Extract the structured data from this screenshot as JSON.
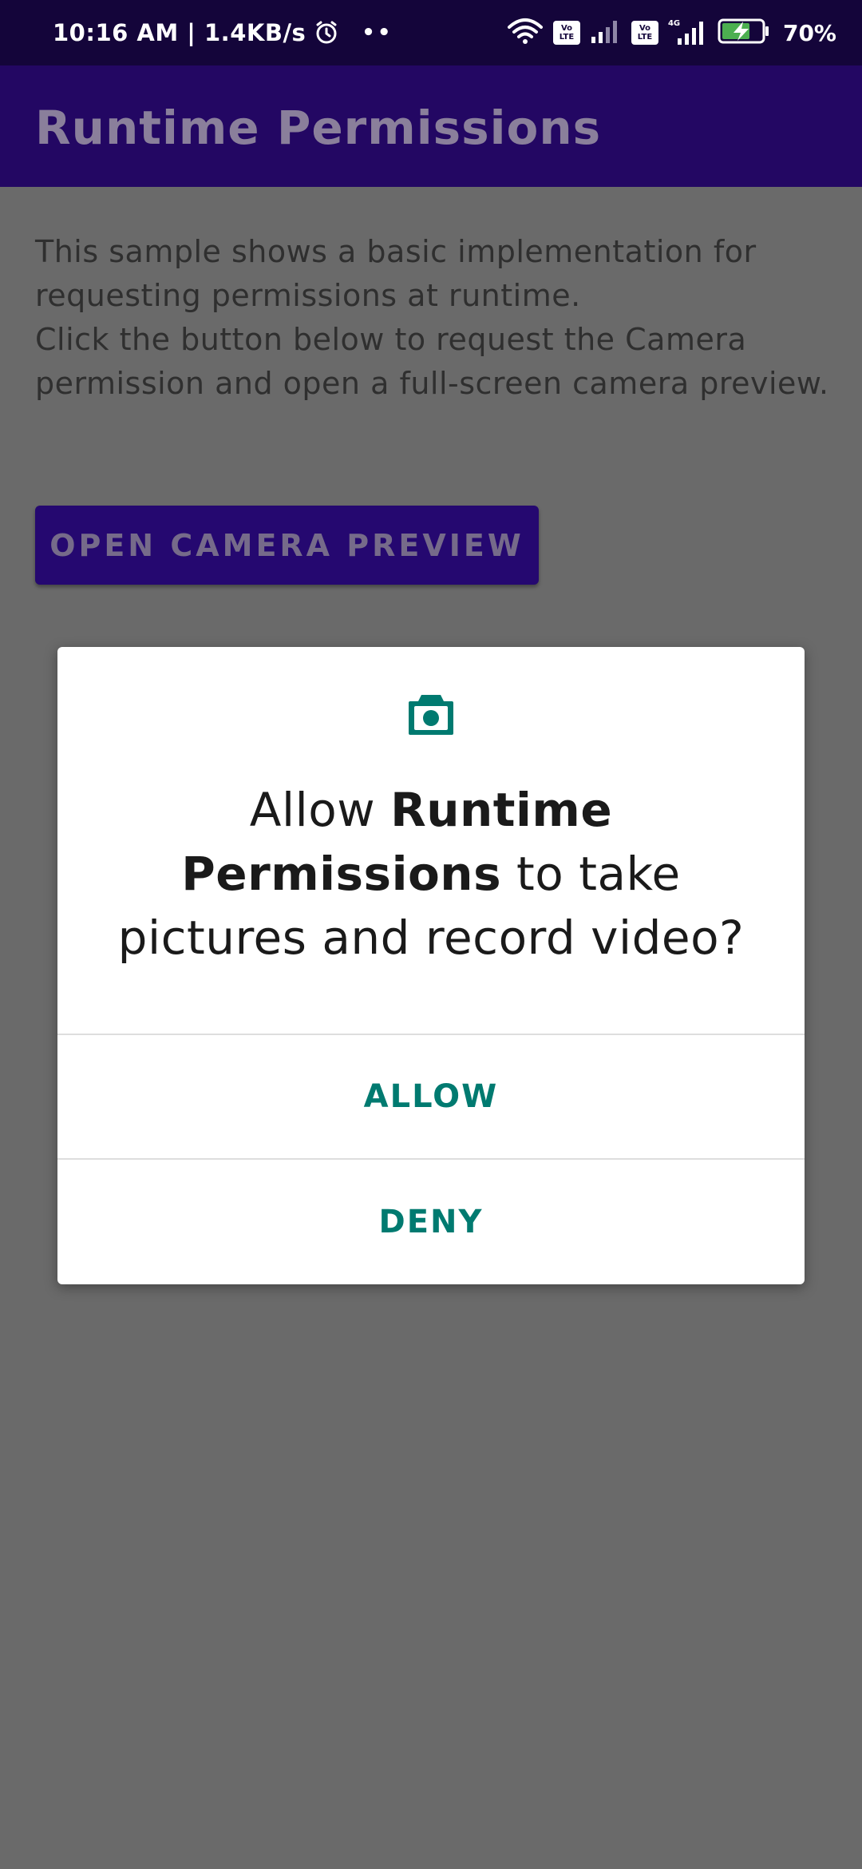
{
  "status_bar": {
    "time_speed": "10:16 AM | 1.4KB/s",
    "dots": "••",
    "volte_label_top": "Vo",
    "volte_label_bottom": "LTE",
    "network_type": "4G",
    "battery_percent": "70%",
    "battery_level": 0.7,
    "icons": [
      "alarm-icon",
      "wifi-icon",
      "volte-icon",
      "signal-icon",
      "volte-icon",
      "signal-icon",
      "battery-charging-icon"
    ]
  },
  "app_bar": {
    "title": "Runtime Permissions"
  },
  "main": {
    "description_line1": "This sample shows a basic implementation for requesting permissions at runtime.",
    "description_line2": "Click the button below to request the Camera permission and open a full-screen camera preview.",
    "open_camera_label": "OPEN CAMERA PREVIEW"
  },
  "dialog": {
    "icon": "camera-icon",
    "message_prefix": "Allow ",
    "message_app_name": "Runtime Permissions",
    "message_suffix": " to take pictures and record video?",
    "allow_label": "ALLOW",
    "deny_label": "DENY"
  },
  "colors": {
    "status_bar_bg": "#14053a",
    "app_bar_bg": "#230763",
    "scrim_bg": "#6a6a6a",
    "accent": "#007a70",
    "button_bg": "#250870"
  }
}
